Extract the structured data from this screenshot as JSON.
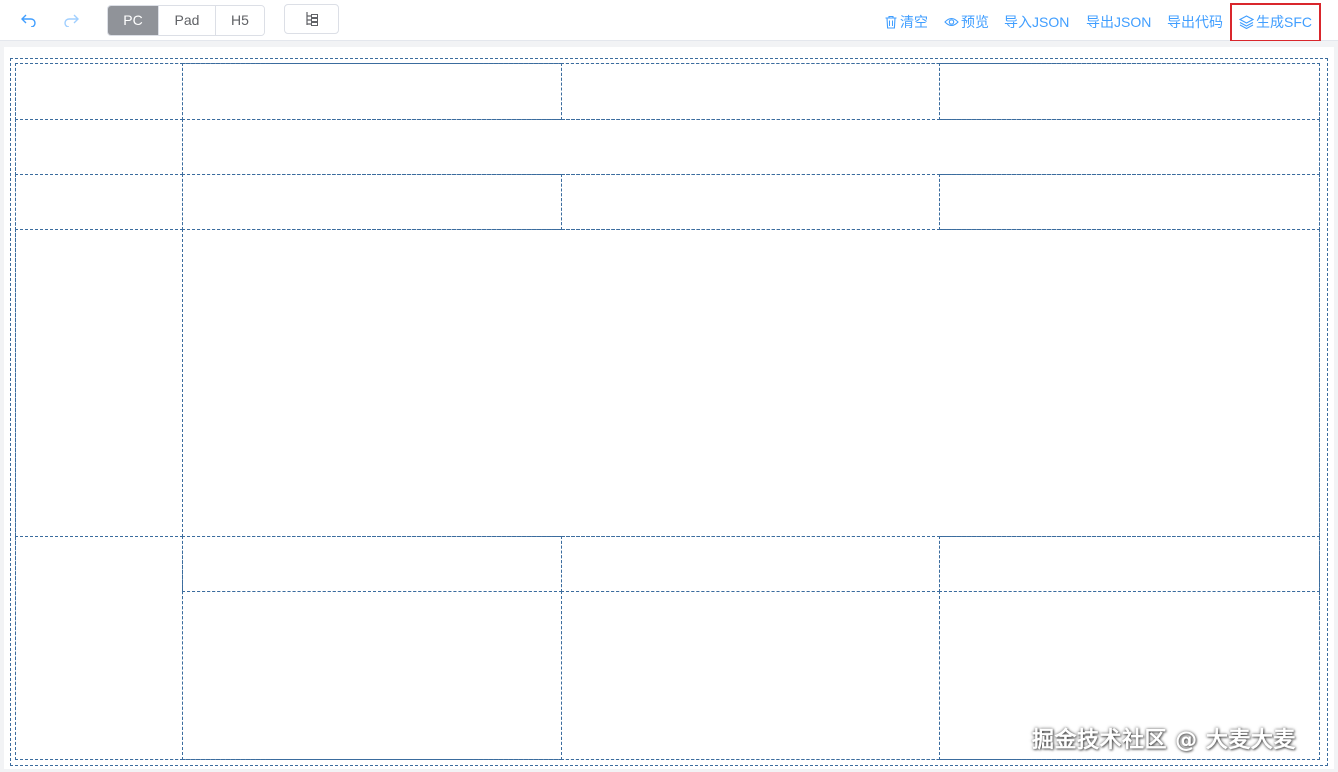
{
  "toolbar": {
    "undo_icon": "undo-icon",
    "redo_icon": "redo-icon",
    "devices": [
      {
        "label": "PC",
        "active": true
      },
      {
        "label": "Pad",
        "active": false
      },
      {
        "label": "H5",
        "active": false
      }
    ],
    "tree_icon": "component-tree-icon",
    "actions": [
      {
        "label": "清空",
        "icon": "trash-icon"
      },
      {
        "label": "预览",
        "icon": "eye-icon"
      },
      {
        "label": "导入JSON",
        "icon": ""
      },
      {
        "label": "导出JSON",
        "icon": ""
      },
      {
        "label": "导出代码",
        "icon": ""
      },
      {
        "label": "生成SFC",
        "icon": "layers-icon"
      }
    ]
  },
  "colors": {
    "accent": "#409eff",
    "active_device_bg": "#909399",
    "grid_border": "#3b6c9e",
    "highlight": "#d9262c",
    "canvas_bg": "#f2f3f5"
  },
  "watermark": "掘金技术社区 @ 大麦大麦"
}
